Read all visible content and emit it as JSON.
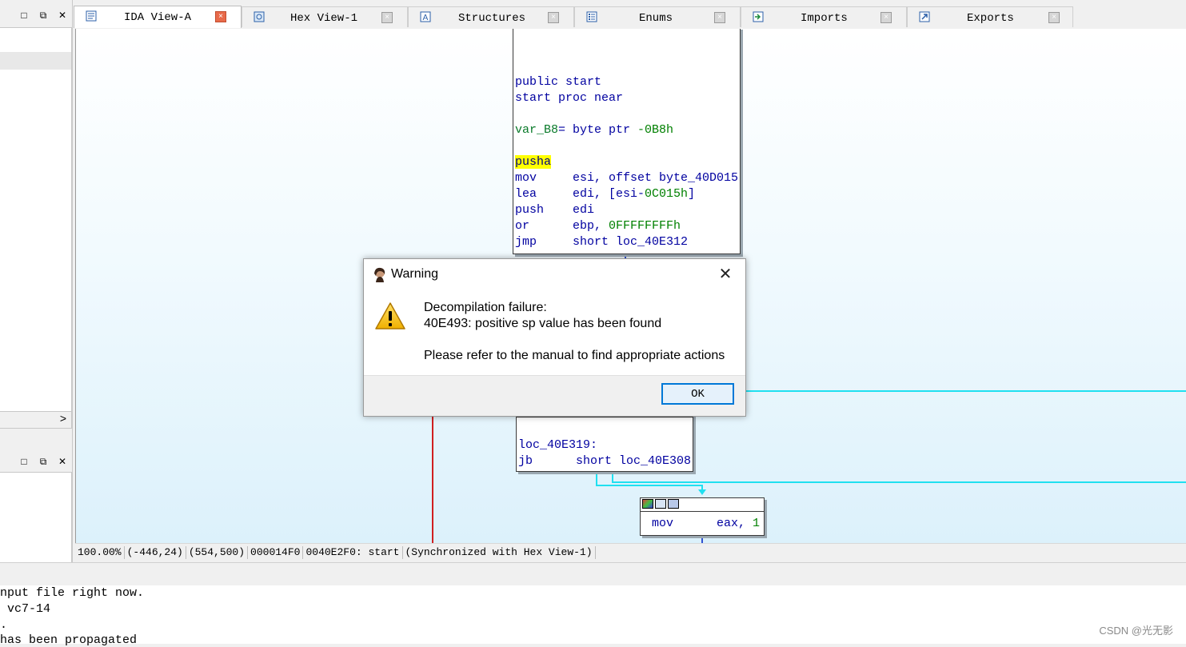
{
  "left_pane": {
    "top_buttons": [
      "□",
      "⧉",
      "✕"
    ],
    "bottom_buttons": [
      "□",
      "⧉",
      "✕"
    ],
    "scroll_right": ">"
  },
  "tabs": [
    {
      "label": "IDA View-A",
      "icon": "ida-view-icon",
      "active": true
    },
    {
      "label": "Hex View-1",
      "icon": "hex-view-icon",
      "active": false
    },
    {
      "label": "Structures",
      "icon": "structures-icon",
      "active": false
    },
    {
      "label": "Enums",
      "icon": "enums-icon",
      "active": false
    },
    {
      "label": "Imports",
      "icon": "imports-icon",
      "active": false
    },
    {
      "label": "Exports",
      "icon": "exports-icon",
      "active": false
    }
  ],
  "tab_close_glyph": "×",
  "code": {
    "block1": [
      {
        "parts": [
          [
            "kw",
            "public start"
          ]
        ]
      },
      {
        "parts": [
          [
            "kw",
            "start proc near"
          ]
        ]
      },
      {
        "parts": [
          [
            "",
            ""
          ]
        ]
      },
      {
        "parts": [
          [
            "var",
            "var_B8"
          ],
          [
            "kw",
            "= byte ptr "
          ],
          [
            "num",
            "-0B8h"
          ]
        ]
      },
      {
        "parts": [
          [
            "",
            ""
          ]
        ]
      },
      {
        "parts": [
          [
            "hl",
            "pusha"
          ]
        ]
      },
      {
        "parts": [
          [
            "kw",
            "mov     esi, offset byte_40D015"
          ]
        ]
      },
      {
        "parts": [
          [
            "kw",
            "lea     edi, [esi-"
          ],
          [
            "num",
            "0C015h"
          ],
          [
            "kw",
            "]"
          ]
        ]
      },
      {
        "parts": [
          [
            "kw",
            "push    edi"
          ]
        ]
      },
      {
        "parts": [
          [
            "kw",
            "or      ebp, "
          ],
          [
            "num",
            "0FFFFFFFFh"
          ]
        ]
      },
      {
        "parts": [
          [
            "kw",
            "jmp     short loc_40E312"
          ]
        ]
      }
    ],
    "block2": [
      {
        "parts": [
          [
            "",
            ""
          ]
        ]
      },
      {
        "parts": [
          [
            "kw",
            "loc_40E319:"
          ]
        ]
      },
      {
        "parts": [
          [
            "kw",
            "jb      short loc_40E308"
          ]
        ]
      }
    ],
    "block3": [
      {
        "parts": [
          [
            "kw",
            "mov      eax, "
          ],
          [
            "num",
            "1"
          ]
        ]
      }
    ]
  },
  "status": {
    "zoom": "100.00%",
    "coord1": "(-446,24)",
    "coord2": "(554,500)",
    "offset": "000014F0",
    "address": "0040E2F0: start",
    "sync": "(Synchronized with Hex View-1)"
  },
  "output": {
    "lines": [
      "nput file right now.",
      " vc7-14",
      ".",
      "has been propagated"
    ]
  },
  "watermark": "CSDN @光无影",
  "dialog": {
    "title": "Warning",
    "close": "✕",
    "line1": "Decompilation failure:",
    "line2": "40E493: positive sp value has been found",
    "line3": "Please refer to the manual to find appropriate actions",
    "ok": "OK"
  }
}
